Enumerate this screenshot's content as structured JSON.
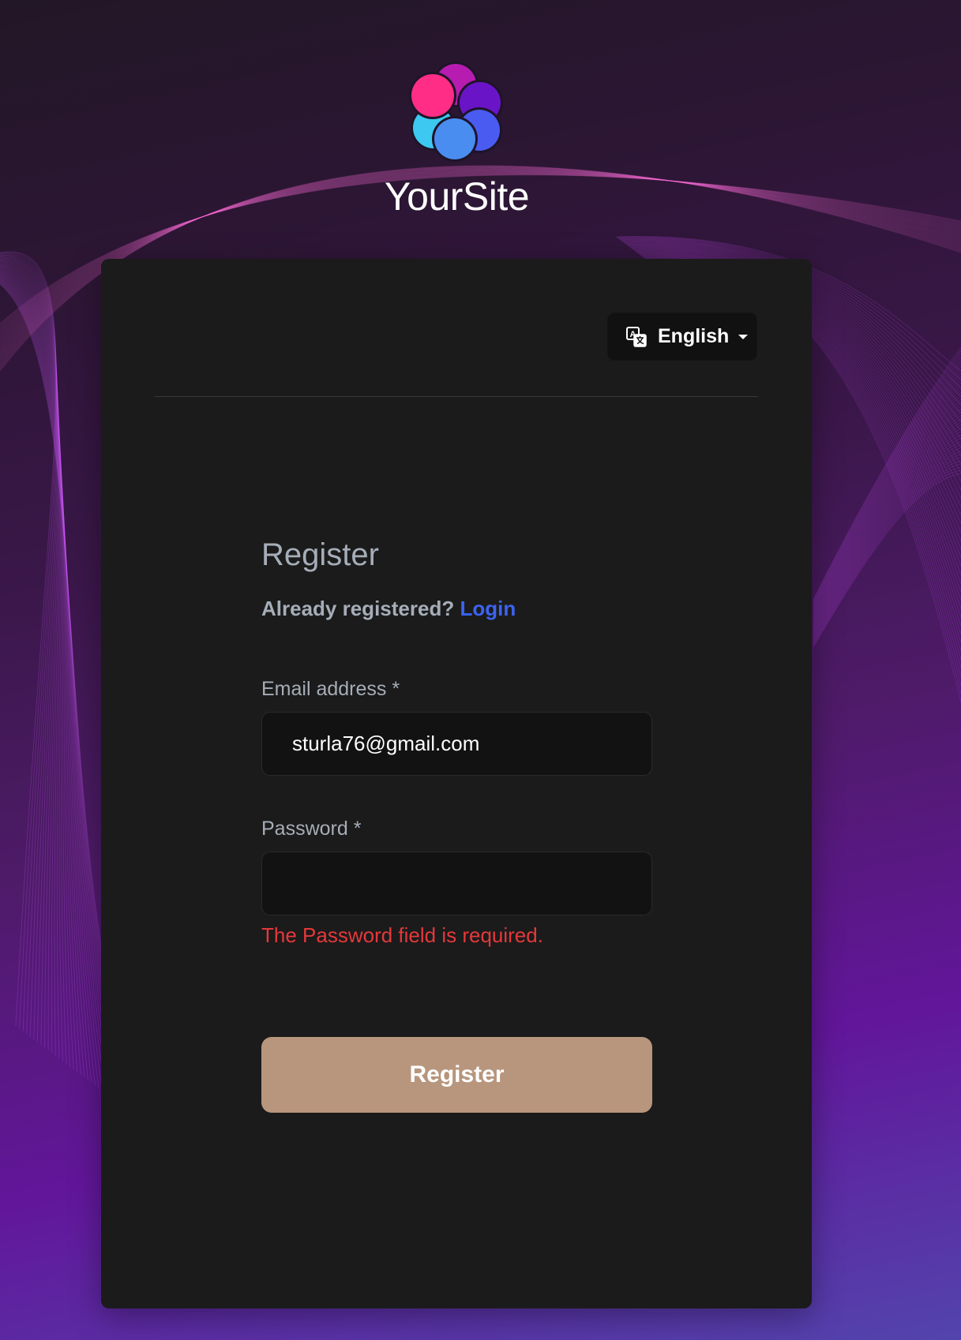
{
  "brand": {
    "name": "YourSite",
    "logo_icon": "flower-circles-logo",
    "logo_colors": [
      "#ff2d86",
      "#b71cb0",
      "#6a14c7",
      "#4a5bf2",
      "#4a8df0",
      "#3cc8f0"
    ]
  },
  "language_selector": {
    "icon": "translate-icon",
    "label": "English",
    "caret_icon": "caret-down-icon"
  },
  "form": {
    "title": "Register",
    "login_prompt": "Already registered?",
    "login_link": "Login",
    "email": {
      "label": "Email address *",
      "value": "sturla76@gmail.com"
    },
    "password": {
      "label": "Password *",
      "value": "",
      "error": "The Password field is required."
    },
    "submit_label": "Register"
  },
  "colors": {
    "card_background": "#1b1b1b",
    "accent_link": "#3b63f2",
    "error": "#e5383b",
    "submit_button": "#b7967d",
    "muted_text": "#a5adb8"
  }
}
